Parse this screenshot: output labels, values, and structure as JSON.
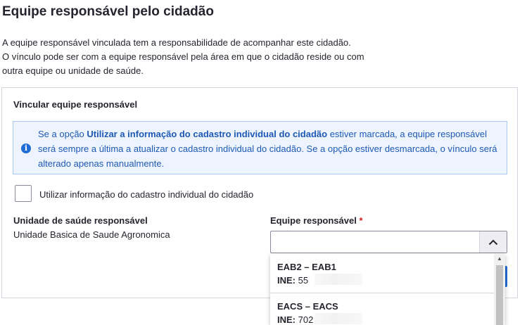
{
  "page": {
    "title": "Equipe responsável pelo cidadão",
    "intro_lines": [
      "A equipe responsável vinculada tem a responsabilidade de acompanhar este cidadão.",
      "O vínculo pode ser com a equipe responsável pela área em que o cidadão reside ou com",
      "outra equipe ou unidade de saúde."
    ]
  },
  "card": {
    "title": "Vincular equipe responsável",
    "alert": {
      "icon": "info-icon",
      "text_prefix": "Se a opção ",
      "text_bold": "Utilizar a informação do cadastro individual do cidadão",
      "text_suffix": " estiver marcada, a equipe responsável será sempre a última a atualizar o cadastro individual do cidadão. Se a opção estiver desmarcada, o vínculo será alterado apenas manualmente."
    },
    "checkbox": {
      "label": "Utilizar informação do cadastro individual do cidadão",
      "checked": false
    },
    "unit": {
      "label": "Unidade de saúde responsável",
      "value": "Unidade Basica de Saude Agronomica"
    },
    "team": {
      "label": "Equipe responsável",
      "required_mark": "*",
      "value": "",
      "options": [
        {
          "name": "EAB2 – EAB1",
          "ine_label": "INE:",
          "ine_value": "55"
        },
        {
          "name": "EACS – EACS",
          "ine_label": "INE:",
          "ine_value": "702"
        }
      ]
    }
  },
  "colors": {
    "accent": "#1f6cd6",
    "alert_bg": "#eef4fe",
    "alert_border": "#aac7f5",
    "alert_text": "#1d59b5",
    "required": "#d01f27"
  }
}
